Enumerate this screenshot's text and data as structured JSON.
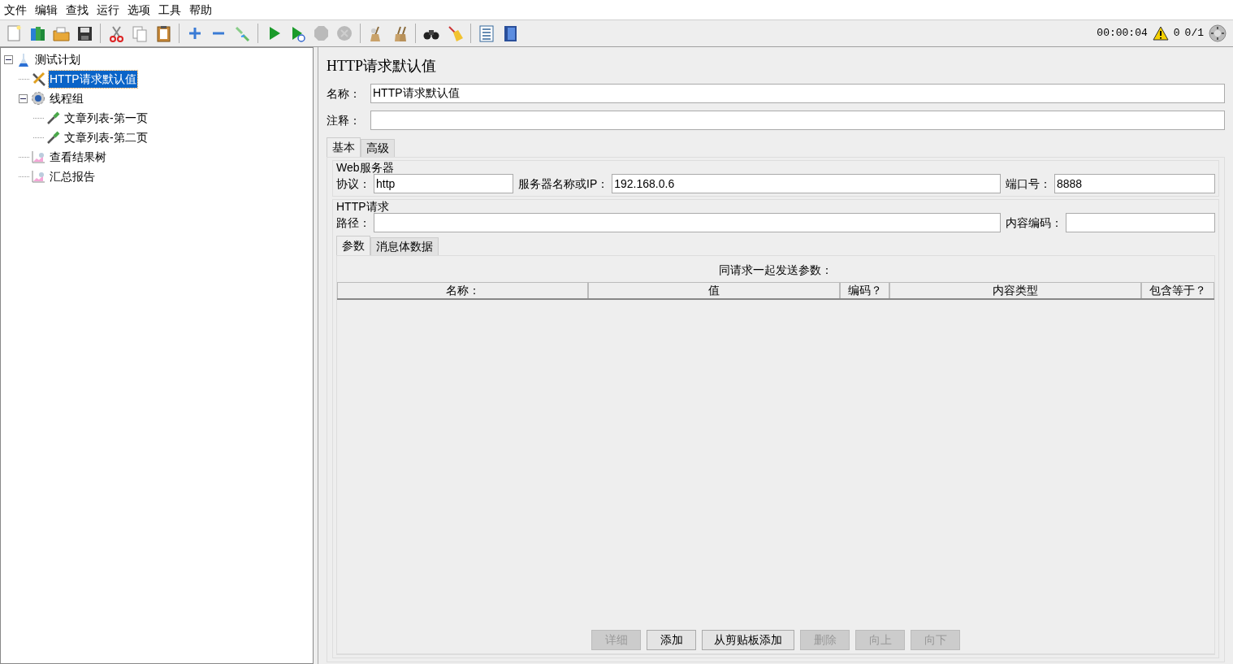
{
  "menu": [
    "文件",
    "编辑",
    "查找",
    "运行",
    "选项",
    "工具",
    "帮助"
  ],
  "toolbar": [
    {
      "kind": "new",
      "disabled": false
    },
    {
      "kind": "templates",
      "disabled": false
    },
    {
      "kind": "open",
      "disabled": false
    },
    {
      "kind": "save",
      "disabled": false
    },
    {
      "kind": "sep"
    },
    {
      "kind": "cut",
      "disabled": false
    },
    {
      "kind": "copy",
      "disabled": false
    },
    {
      "kind": "paste",
      "disabled": false
    },
    {
      "kind": "sep"
    },
    {
      "kind": "expand",
      "disabled": false
    },
    {
      "kind": "collapse",
      "disabled": false
    },
    {
      "kind": "toggle",
      "disabled": false
    },
    {
      "kind": "sep"
    },
    {
      "kind": "start",
      "disabled": false
    },
    {
      "kind": "start-no-pause",
      "disabled": false
    },
    {
      "kind": "stop",
      "disabled": true
    },
    {
      "kind": "shutdown",
      "disabled": true
    },
    {
      "kind": "sep"
    },
    {
      "kind": "clear",
      "disabled": false
    },
    {
      "kind": "clear-all",
      "disabled": false
    },
    {
      "kind": "sep"
    },
    {
      "kind": "search",
      "disabled": false
    },
    {
      "kind": "reset-search",
      "disabled": false
    },
    {
      "kind": "sep"
    },
    {
      "kind": "function",
      "disabled": false
    },
    {
      "kind": "help",
      "disabled": false
    }
  ],
  "status": {
    "timer": "00:00:04",
    "warnings": "0",
    "threads": "0/1"
  },
  "tree": [
    {
      "label": "测试计划",
      "kind": "plan",
      "selected": false,
      "expanded": true,
      "children": [
        {
          "label": "HTTP请求默认值",
          "kind": "config",
          "selected": true
        },
        {
          "label": "线程组",
          "kind": "threads",
          "selected": false,
          "expanded": true,
          "children": [
            {
              "label": "文章列表-第一页",
              "kind": "sampler",
              "selected": false
            },
            {
              "label": "文章列表-第二页",
              "kind": "sampler",
              "selected": false
            }
          ]
        },
        {
          "label": "查看结果树",
          "kind": "listener",
          "selected": false
        },
        {
          "label": "汇总报告",
          "kind": "listener",
          "selected": false
        }
      ]
    }
  ],
  "panel": {
    "title": "HTTP请求默认值",
    "fields": [
      {
        "label": "名称：",
        "value": "HTTP请求默认值"
      },
      {
        "label": "注释："
      }
    ],
    "tabs": [
      {
        "label": "基本",
        "selected": true
      },
      {
        "label": "高级",
        "selected": false
      }
    ],
    "web_server": {
      "legend": "Web服务器",
      "protocol_label": "协议：",
      "protocol": "http",
      "server_label": "服务器名称或IP：",
      "server": "192.168.0.6",
      "port_label": "端口号：",
      "port": "8888"
    },
    "http_request": {
      "legend": "HTTP请求",
      "path_label": "路径：",
      "encoding_label": "内容编码："
    },
    "param_tabs": [
      {
        "label": "参数",
        "selected": true
      },
      {
        "label": "消息体数据",
        "selected": false
      }
    ],
    "table": {
      "caption": "同请求一起发送参数：",
      "columns": [
        "名称：",
        "值",
        "编码？",
        "内容类型",
        "包含等于？"
      ]
    },
    "buttons": [
      {
        "label": "详细",
        "disabled": true
      },
      {
        "label": "添加",
        "disabled": false
      },
      {
        "label": "从剪贴板添加",
        "disabled": false
      },
      {
        "label": "删除",
        "disabled": true
      },
      {
        "label": "向上",
        "disabled": true
      },
      {
        "label": "向下",
        "disabled": true
      }
    ]
  }
}
